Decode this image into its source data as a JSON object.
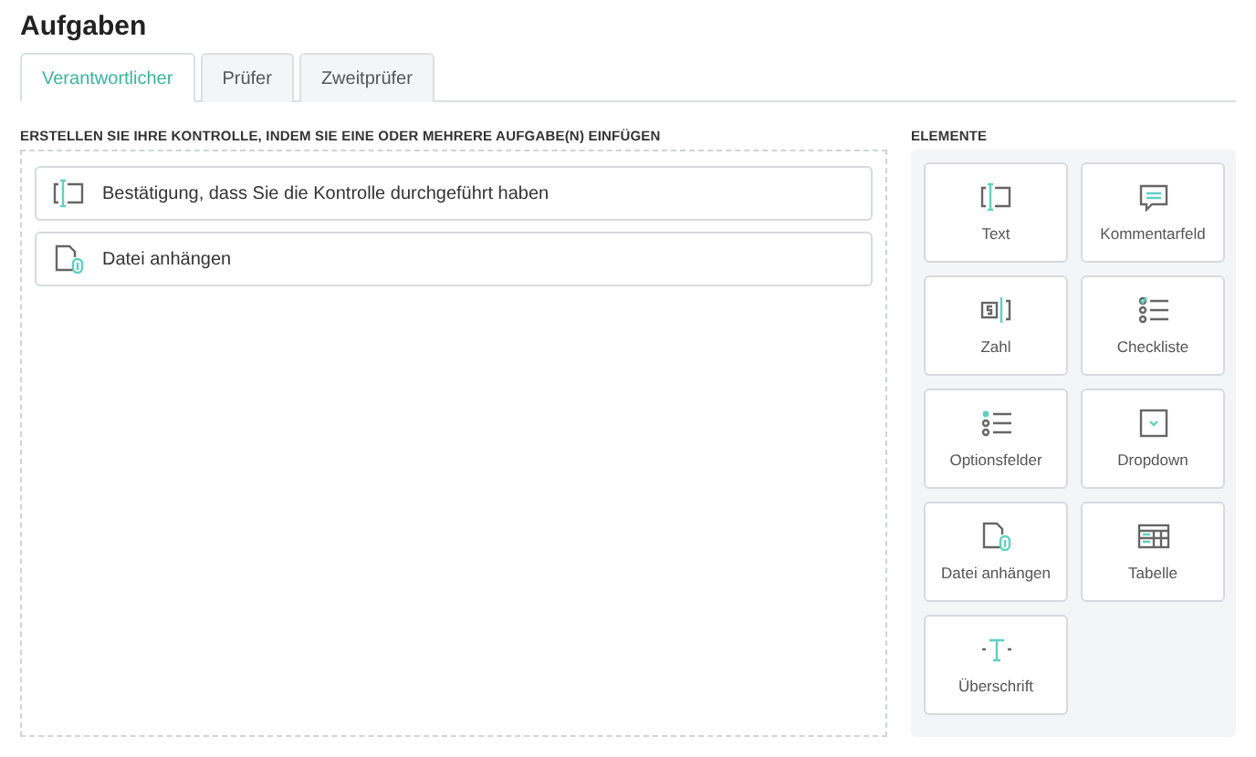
{
  "title": "Aufgaben",
  "tabs": [
    {
      "label": "Verantwortlicher",
      "selected": true
    },
    {
      "label": "Prüfer",
      "selected": false
    },
    {
      "label": "Zweitprüfer",
      "selected": false
    }
  ],
  "builder": {
    "heading": "ERSTELLEN SIE IHRE KONTROLLE, INDEM SIE EINE ODER MEHRERE AUFGABE(N) EINFÜGEN",
    "tasks": [
      {
        "kind": "text",
        "label": "Bestätigung, dass Sie die Kontrolle durchgeführt haben"
      },
      {
        "kind": "file",
        "label": "Datei anhängen"
      }
    ]
  },
  "elements": {
    "heading": "ELEMENTE",
    "items": [
      {
        "kind": "text",
        "label": "Text"
      },
      {
        "kind": "comment",
        "label": "Kommentarfeld"
      },
      {
        "kind": "number",
        "label": "Zahl"
      },
      {
        "kind": "checklist",
        "label": "Checkliste"
      },
      {
        "kind": "options",
        "label": "Optionsfelder"
      },
      {
        "kind": "dropdown",
        "label": "Dropdown"
      },
      {
        "kind": "file",
        "label": "Datei anhängen"
      },
      {
        "kind": "table",
        "label": "Tabelle"
      },
      {
        "kind": "heading",
        "label": "Überschrift"
      }
    ]
  }
}
